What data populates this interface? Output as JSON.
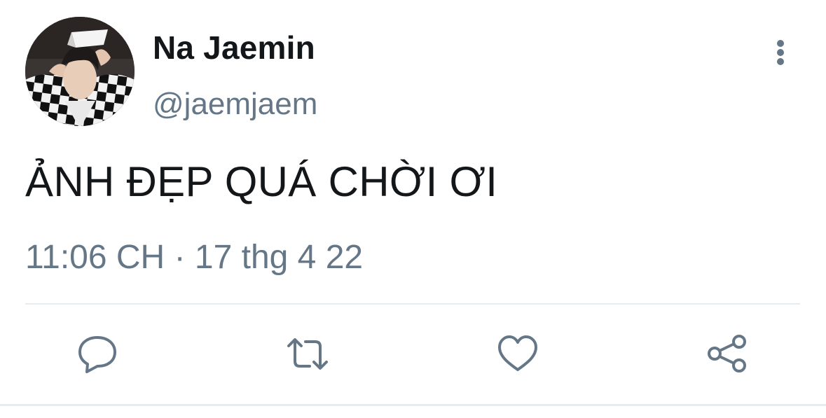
{
  "user": {
    "display_name": "Na Jaemin",
    "handle": "@jaemjaem",
    "avatar_icon": "profile-photo"
  },
  "tweet": {
    "text": "ẢNH ĐẸP QUÁ CHỜI ƠI",
    "time": "11:06 CH",
    "separator": "·",
    "date": "17 thg 4 22"
  },
  "menu": {
    "icon": "more-vertical-icon"
  },
  "actions": [
    {
      "icon": "reply-icon"
    },
    {
      "icon": "retweet-icon"
    },
    {
      "icon": "like-icon"
    },
    {
      "icon": "share-icon"
    }
  ],
  "colors": {
    "text_primary": "#14171a",
    "text_secondary": "#657786",
    "divider": "#e6ecf0"
  }
}
